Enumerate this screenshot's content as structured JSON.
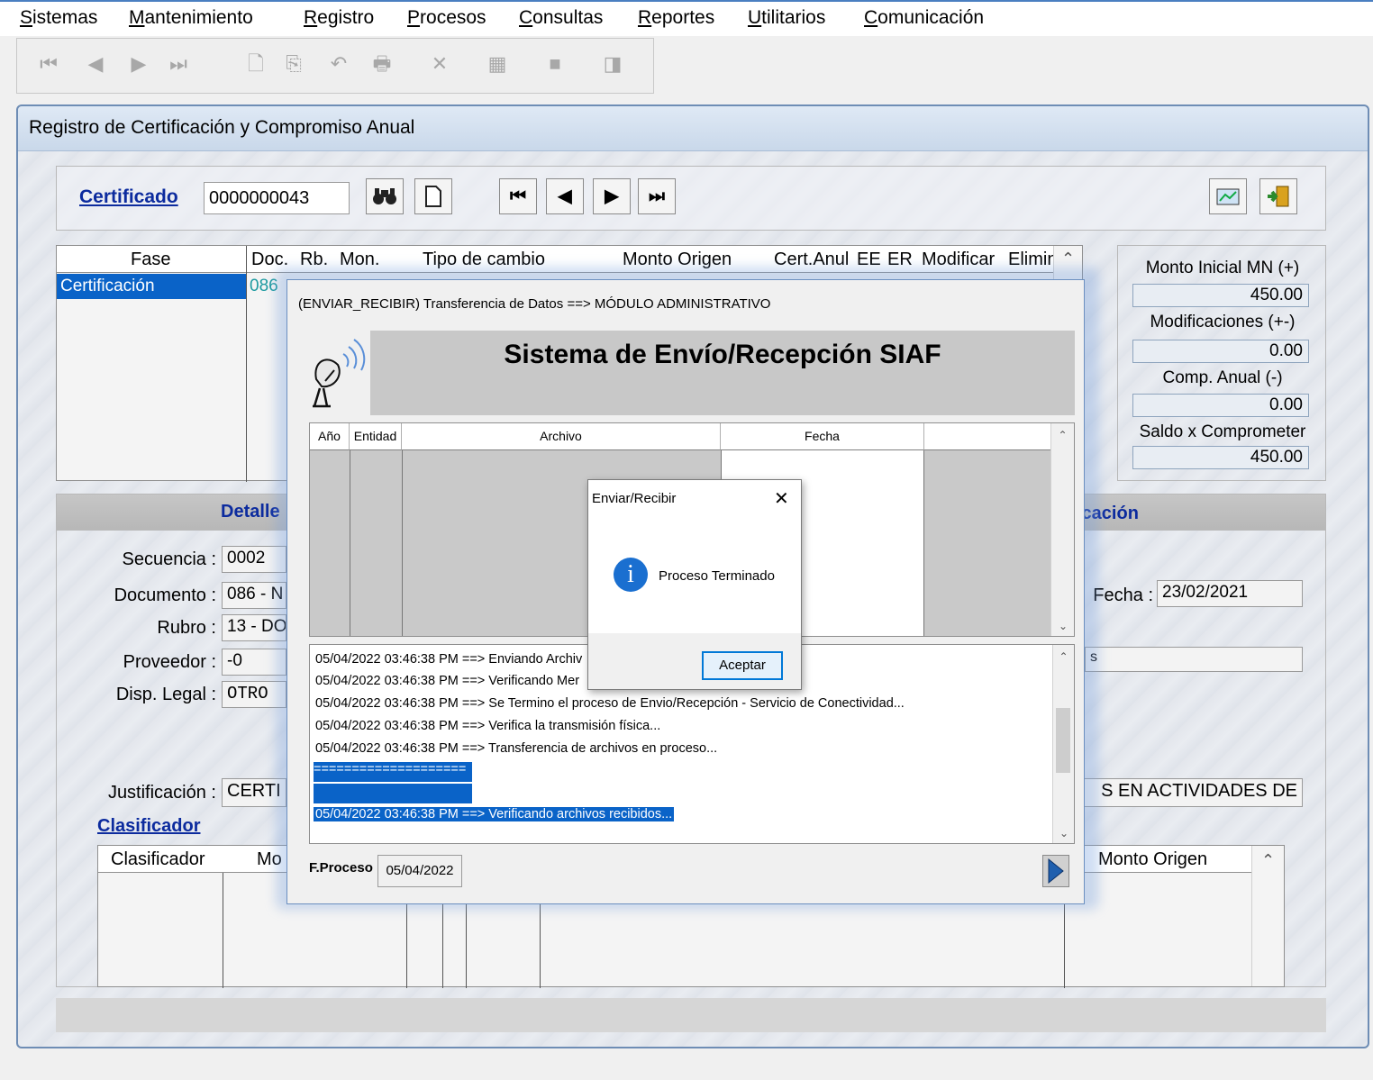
{
  "menu": {
    "items": [
      {
        "u": "S",
        "rest": "istemas"
      },
      {
        "u": "M",
        "rest": "antenimiento"
      },
      {
        "u": "R",
        "rest": "egistro"
      },
      {
        "u": "P",
        "rest": "rocesos"
      },
      {
        "u": "C",
        "rest": "onsultas"
      },
      {
        "u": "R",
        "rest": "eportes"
      },
      {
        "u": "U",
        "rest": "tilitarios"
      },
      {
        "u": "C",
        "rest": "omunicación"
      }
    ]
  },
  "toolbar": {
    "icons": [
      "first-record-icon",
      "prev-record-icon",
      "next-record-icon",
      "last-record-icon",
      "new-doc-icon",
      "copy-icon",
      "undo-icon",
      "print-icon",
      "delete-icon",
      "save-icon",
      "stop-icon",
      "exit-icon"
    ],
    "glyphs": [
      "⏮",
      "◀",
      "▶",
      "⏭",
      "🗋",
      "⎘",
      "↶",
      "🖶",
      "✕",
      "▦",
      "■",
      "◨"
    ]
  },
  "main": {
    "window_title": "Registro de Certificación y Compromiso Anual",
    "certificado_label": "Certificado",
    "certificado_value": "0000000043",
    "nav_glyphs": [
      "⏮",
      "◀",
      "▶",
      "⏭"
    ],
    "grid": {
      "columns": [
        "Fase",
        "Doc.",
        "Rb.",
        "Mon.",
        "Tipo de cambio",
        "Monto Origen",
        "Cert.Anul",
        "EE",
        "ER",
        "Modificar",
        "Eliminar"
      ],
      "row": {
        "fase": "Certificación",
        "doc": "086"
      }
    },
    "side": {
      "monto_inicial_label": "Monto Inicial MN (+)",
      "monto_inicial": "450.00",
      "modificaciones_label": "Modificaciones (+-)",
      "modificaciones": "0.00",
      "comp_anual_label": "Comp. Anual (-)",
      "comp_anual": "0.00",
      "saldo_label": "Saldo x Comprometer",
      "saldo": "450.00"
    },
    "detalle": {
      "title_left": "Detalle",
      "title_right": "icación",
      "secuencia_label": "Secuencia :",
      "secuencia": "0002",
      "documento_label": "Documento :",
      "documento": "086 - N",
      "rubro_label": "Rubro :",
      "rubro": "13 - DO",
      "proveedor_label": "Proveedor :",
      "proveedor": "-0",
      "disp_legal_label": "Disp. Legal :",
      "disp_legal": "OTRO",
      "fecha_label": "Fecha :",
      "fecha": "23/02/2021",
      "right_field_partial": "s",
      "justificacion_label": "Justificación :",
      "justificacion_left": "CERTI",
      "justificacion_right": "S EN ACTIVIDADES DE",
      "clasificador_link": "Clasificador",
      "bottom_columns": [
        "Clasificador",
        "Mo",
        "Monto Origen"
      ]
    }
  },
  "modal": {
    "title": "(ENVIAR_RECIBIR) Transferencia de Datos ==> MÓDULO ADMINISTRATIVO",
    "banner": "Sistema de Envío/Recepción SIAF",
    "columns": [
      "Año",
      "Entidad",
      "Archivo",
      "Fecha"
    ],
    "log": [
      "05/04/2022 03:46:38 PM ==> Enviando Archiv",
      "05/04/2022 03:46:38 PM ==> Verificando Mer",
      "05/04/2022 03:46:38 PM ==> Se Termino el proceso de Envio/Recepción - Servicio de Conectividad...",
      "05/04/2022 03:46:38 PM ==> Verifica la transmisión física...",
      "05/04/2022 03:46:38 PM ==> Transferencia de archivos en proceso...",
      "====================",
      "",
      "05/04/2022 03:46:38 PM ==> Verificando archivos recibidos..."
    ],
    "fproceso_label": "F.Proceso",
    "fproceso": "05/04/2022"
  },
  "dialog": {
    "title": "Enviar/Recibir",
    "message": "Proceso Terminado",
    "ok": "Aceptar",
    "icon": "info-icon"
  }
}
